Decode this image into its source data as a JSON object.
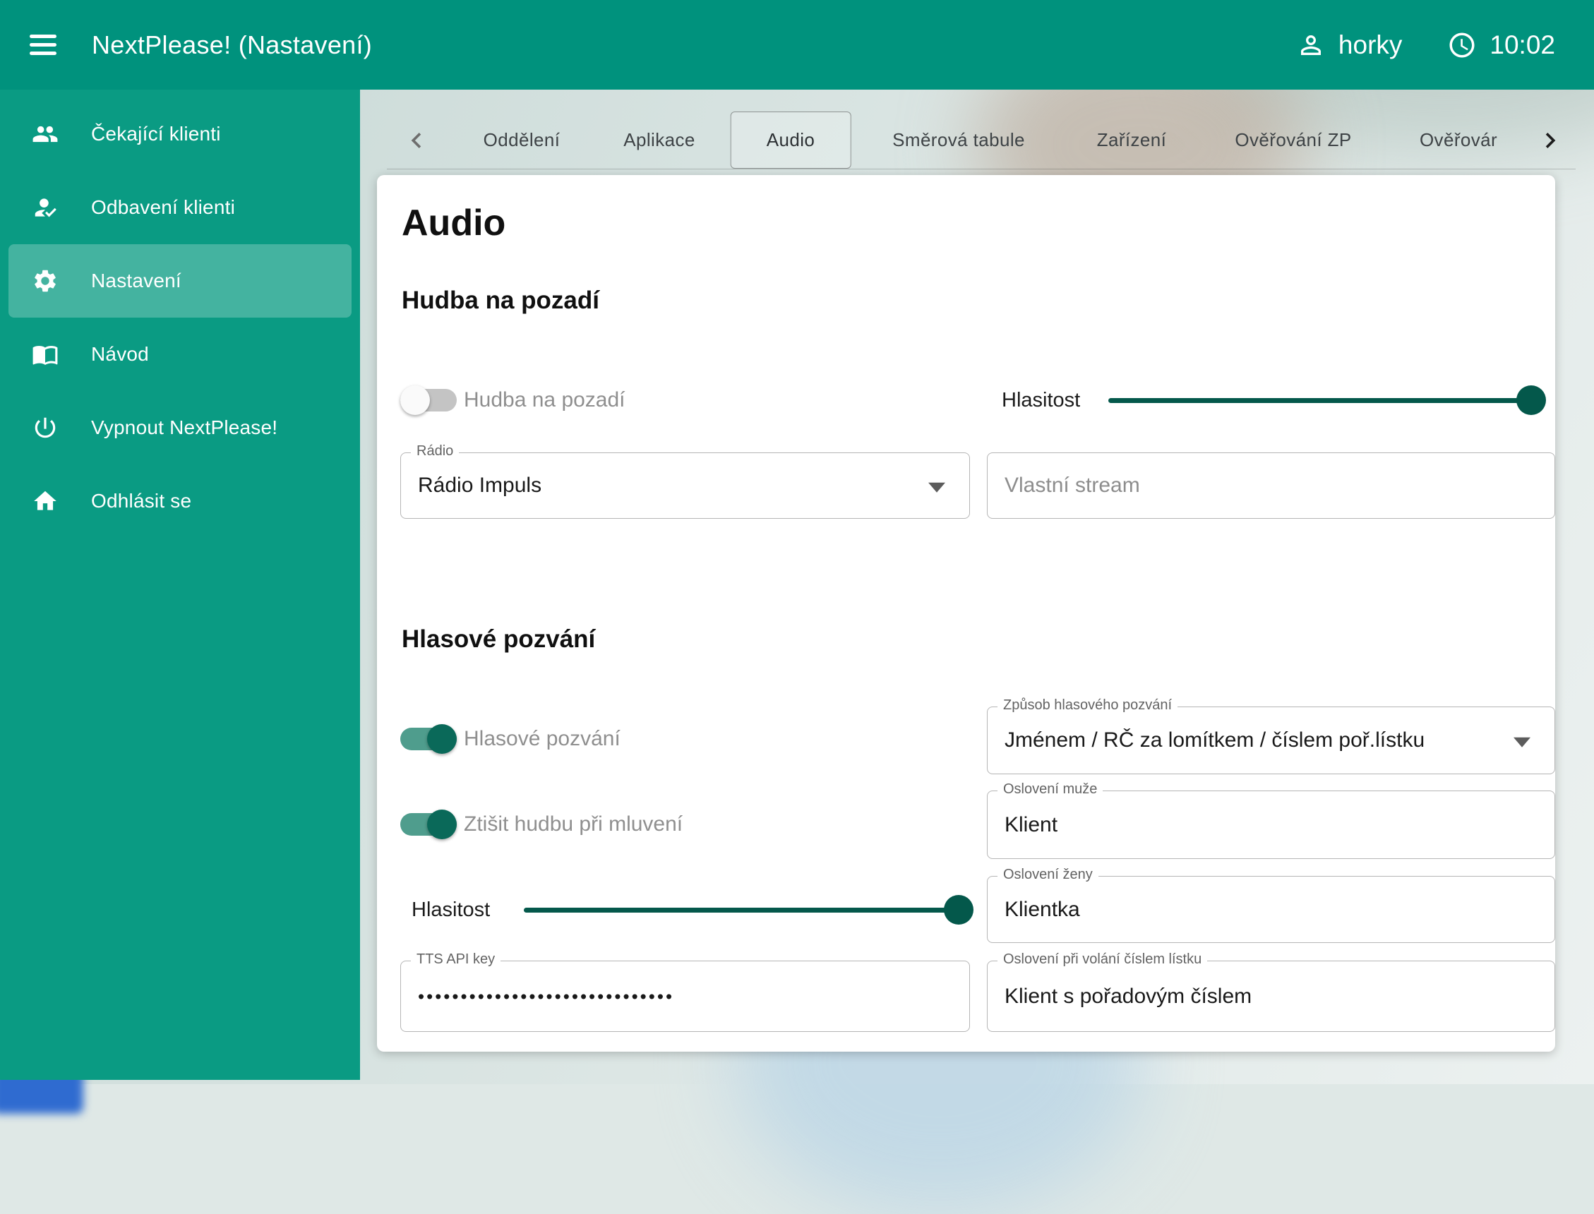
{
  "header": {
    "title": "NextPlease! (Nastavení)",
    "user": "horky",
    "time": "10:02"
  },
  "sidebar": {
    "items": [
      {
        "label": "Čekající klienti",
        "icon": "people-icon",
        "selected": false
      },
      {
        "label": "Odbavení klienti",
        "icon": "person-check-icon",
        "selected": false
      },
      {
        "label": "Nastavení",
        "icon": "gear-icon",
        "selected": true
      },
      {
        "label": "Návod",
        "icon": "book-icon",
        "selected": false
      },
      {
        "label": "Vypnout NextPlease!",
        "icon": "power-icon",
        "selected": false
      },
      {
        "label": "Odhlásit se",
        "icon": "home-icon",
        "selected": false
      }
    ]
  },
  "tabs": {
    "items": [
      "Oddělení",
      "Aplikace",
      "Audio",
      "Směrová tabule",
      "Zařízení",
      "Ověřování ZP",
      "Ověřovár"
    ],
    "selected": "Audio"
  },
  "content": {
    "page_title": "Audio",
    "music_section": {
      "title": "Hudba na pozadí",
      "toggle_label": "Hudba na pozadí",
      "toggle_on": false,
      "volume_label": "Hlasitost",
      "volume_percent": 100,
      "radio_label": "Rádio",
      "radio_value": "Rádio Impuls",
      "stream_label": "Vlastní stream",
      "stream_value": ""
    },
    "voice_section": {
      "title": "Hlasové pozvání",
      "voice_toggle_label": "Hlasové pozvání",
      "voice_toggle_on": true,
      "mute_toggle_label": "Ztišit hudbu při mluvení",
      "mute_toggle_on": true,
      "volume_label": "Hlasitost",
      "volume_percent": 100,
      "tts_label": "TTS API key",
      "tts_value_masked": "••••••••••••••••••••••••••••••",
      "method_label": "Způsob hlasového pozvání",
      "method_value": "Jménem / RČ za lomítkem / číslem poř.lístku",
      "male_label": "Oslovení muže",
      "male_value": "Klient",
      "female_label": "Oslovení ženy",
      "female_value": "Klientka",
      "number_label": "Oslovení při volání číslem lístku",
      "number_value": "Klient s pořadovým číslem"
    }
  },
  "colors": {
    "header_bg": "#00927d",
    "sidebar_bg": "#0a9b83",
    "accent_dark": "#04584b",
    "toggle_on_track": "#4f9d8d",
    "toggle_on_thumb": "#0a6959"
  }
}
